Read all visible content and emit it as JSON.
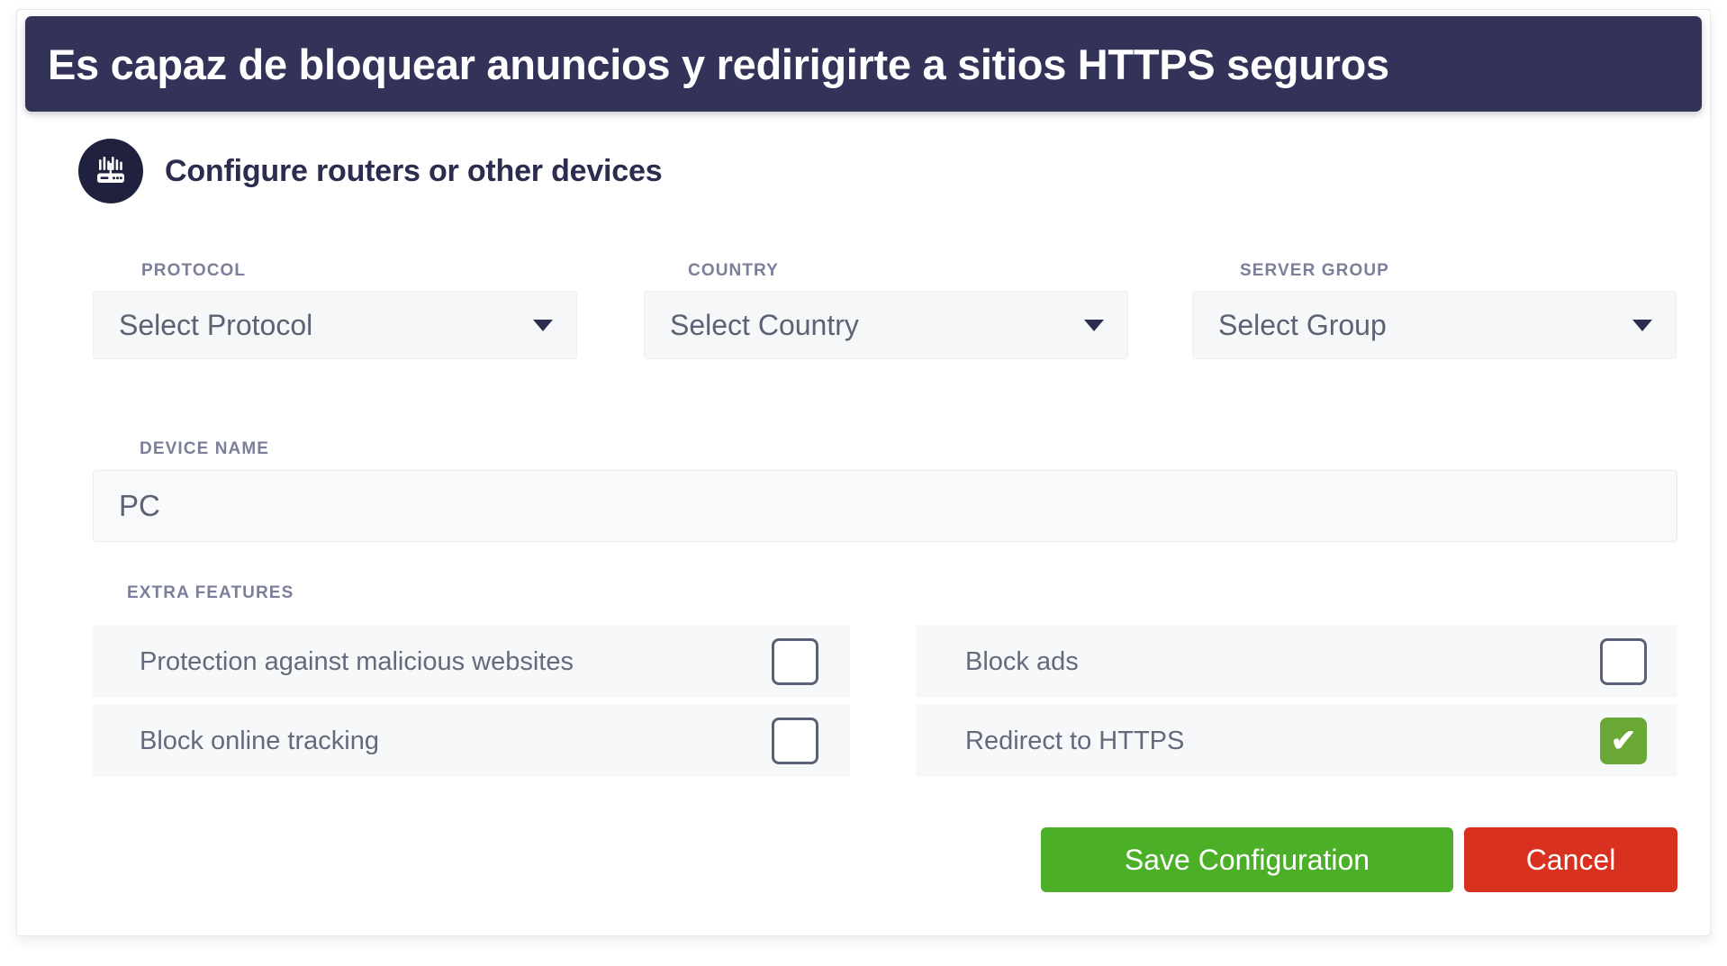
{
  "banner": {
    "text": "Es capaz de bloquear anuncios y redirigirte a sitios HTTPS seguros",
    "background": "#33335a",
    "text_color": "#ffffff"
  },
  "header": {
    "icon": "router-icon",
    "title": "Configure routers or other devices"
  },
  "form": {
    "selects": [
      {
        "label": "PROTOCOL",
        "value": "Select Protocol",
        "icon": "chevron-down-icon"
      },
      {
        "label": "COUNTRY",
        "value": "Select Country",
        "icon": "chevron-down-icon"
      },
      {
        "label": "SERVER GROUP",
        "value": "Select Group",
        "icon": "chevron-down-icon"
      }
    ],
    "device_name": {
      "label": "DEVICE NAME",
      "value": "PC"
    },
    "extra_features": {
      "label": "EXTRA FEATURES",
      "items": [
        {
          "label": "Protection against malicious websites",
          "checked": false
        },
        {
          "label": "Block online tracking",
          "checked": false
        },
        {
          "label": "Block ads",
          "checked": false
        },
        {
          "label": "Redirect to HTTPS",
          "checked": true
        }
      ],
      "checked_color": "#69a834",
      "checkmark": "✔"
    }
  },
  "actions": {
    "save_label": "Save Configuration",
    "save_color": "#4caf28",
    "cancel_label": "Cancel",
    "cancel_color": "#d8311f"
  }
}
